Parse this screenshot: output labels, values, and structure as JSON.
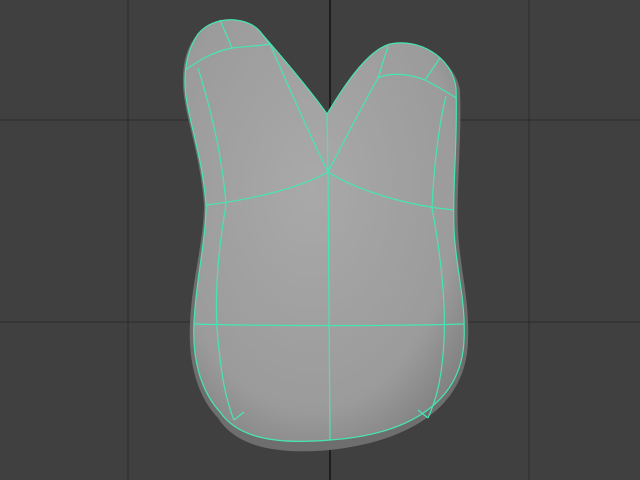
{
  "viewport": {
    "background_color": "#404040",
    "grid_line_color": "#2a2a2a",
    "grid_axis_color": "#222222",
    "grid_visible": true
  },
  "mesh": {
    "shape": "two-lobed rounded blob (tooth-like) with subdivision wireframe",
    "fill_color": "#9c9c9c",
    "fill_highlight_color": "#a6a6a6",
    "shadow_color": "#6e6e6e",
    "wireframe_color": "#46e6b4",
    "selected": true
  }
}
